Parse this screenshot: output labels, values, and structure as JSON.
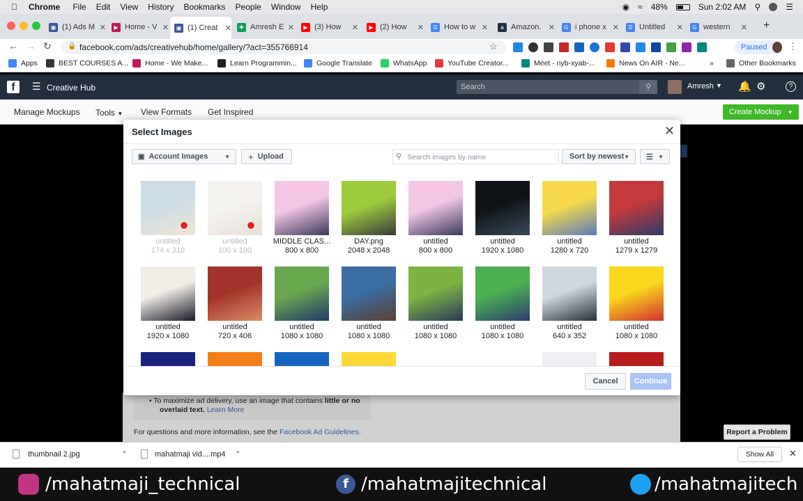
{
  "macmenu": {
    "app": "Chrome",
    "items": [
      "File",
      "Edit",
      "View",
      "History",
      "Bookmarks",
      "People",
      "Window",
      "Help"
    ],
    "battery": "48%",
    "clock": "Sun 2:02 AM"
  },
  "tabs": [
    {
      "label": "(1) Ads M",
      "icon_color": "#3b5998",
      "glyph": "▣"
    },
    {
      "label": "Home - V",
      "icon_color": "#c2185b",
      "glyph": "▶"
    },
    {
      "label": "(1) Creat",
      "icon_color": "#3b5998",
      "glyph": "▣"
    },
    {
      "label": "Amresh E",
      "icon_color": "#0f9d58",
      "glyph": "✚"
    },
    {
      "label": "(3) How",
      "icon_color": "#ff0000",
      "glyph": "▶"
    },
    {
      "label": "(2) How",
      "icon_color": "#ff0000",
      "glyph": "▶"
    },
    {
      "label": "How to w",
      "icon_color": "#4285f4",
      "glyph": "☰"
    },
    {
      "label": "Amazon.",
      "icon_color": "#232f3e",
      "glyph": "a"
    },
    {
      "label": "i phone x",
      "icon_color": "#4285f4",
      "glyph": "G"
    },
    {
      "label": "Untitled",
      "icon_color": "#4285f4",
      "glyph": "☰"
    },
    {
      "label": "western",
      "icon_color": "#4285f4",
      "glyph": "G"
    }
  ],
  "address": {
    "url": "facebook.com/ads/creativehub/home/gallery/?act=355766914",
    "paused": "Paused"
  },
  "bookmarks": [
    {
      "label": "Apps",
      "color": "#4285f4"
    },
    {
      "label": "BEST COURSES A...",
      "color": "#333"
    },
    {
      "label": "Home - We Make...",
      "color": "#c2185b"
    },
    {
      "label": "Learn Programmin...",
      "color": "#222"
    },
    {
      "label": "Google Translate",
      "color": "#4285f4"
    },
    {
      "label": "WhatsApp",
      "color": "#25d366"
    },
    {
      "label": "YouTube Creator...",
      "color": "#e53935"
    },
    {
      "label": "Meet - nyb-xyab-...",
      "color": "#00897b"
    },
    {
      "label": "News On AIR - Ne...",
      "color": "#f57c00"
    },
    {
      "label": "Other Bookmarks",
      "color": "#666"
    }
  ],
  "fbheader": {
    "title": "Creative Hub",
    "search_placeholder": "Search",
    "user": "Amresh"
  },
  "subnav": {
    "manage": "Manage Mockups",
    "tools": "Tools",
    "formats": "View Formats",
    "inspired": "Get Inspired",
    "create": "Create Mockup"
  },
  "modal": {
    "title": "Select Images",
    "source": "Account Images",
    "upload": "Upload",
    "search_placeholder": "Search images by name",
    "sort": "Sort by newest",
    "cancel": "Cancel",
    "continue": "Continue"
  },
  "images": [
    {
      "name": "untitled",
      "size": "174 x 310",
      "dim": true,
      "c1": "#8fb3c9",
      "c2": "#d8c79a"
    },
    {
      "name": "untitled",
      "size": "100 x 100",
      "dim": true,
      "c1": "#e6e2dc",
      "c2": "#c9b9a8"
    },
    {
      "name": "MIDDLE CLAS...",
      "size": "800 x 800",
      "dim": false,
      "c1": "#f3c6e6",
      "c2": "#3a3a5a"
    },
    {
      "name": "DAY.png",
      "size": "2048 x 2048",
      "dim": false,
      "c1": "#9ccc3c",
      "c2": "#3b3b3b"
    },
    {
      "name": "untitled",
      "size": "800 x 800",
      "dim": false,
      "c1": "#f3c6e6",
      "c2": "#3a3a5a"
    },
    {
      "name": "untitled",
      "size": "1920 x 1080",
      "dim": false,
      "c1": "#101418",
      "c2": "#3a4a5a"
    },
    {
      "name": "untitled",
      "size": "1280 x 720",
      "dim": false,
      "c1": "#f5d94a",
      "c2": "#5a7bbd"
    },
    {
      "name": "untitled",
      "size": "1279 x 1279",
      "dim": false,
      "c1": "#c33a3a",
      "c2": "#2b3b6a"
    },
    {
      "name": "untitled",
      "size": "1920 x 1080",
      "dim": false,
      "c1": "#f0ece6",
      "c2": "#1a1a2a"
    },
    {
      "name": "untitled",
      "size": "720 x 406",
      "dim": false,
      "c1": "#a3332a",
      "c2": "#d98b66"
    },
    {
      "name": "untitled",
      "size": "1080 x 1080",
      "dim": false,
      "c1": "#6aa84f",
      "c2": "#1f3a6a"
    },
    {
      "name": "untitled",
      "size": "1080 x 1080",
      "dim": false,
      "c1": "#3a6ea5",
      "c2": "#5a4032"
    },
    {
      "name": "untitled",
      "size": "1080 x 1080",
      "dim": false,
      "c1": "#7cb342",
      "c2": "#2a3a5a"
    },
    {
      "name": "untitled",
      "size": "1080 x 1080",
      "dim": false,
      "c1": "#4caf50",
      "c2": "#2c3e70"
    },
    {
      "name": "untitled",
      "size": "640 x 352",
      "dim": false,
      "c1": "#cfd8dc",
      "c2": "#263238"
    },
    {
      "name": "untitled",
      "size": "1080 x 1080",
      "dim": false,
      "c1": "#f9d71c",
      "c2": "#d32f2f"
    },
    {
      "name": "",
      "size": "",
      "dim": false,
      "c1": "#1a237e",
      "c2": "#5c6bc0"
    },
    {
      "name": "",
      "size": "",
      "dim": false,
      "c1": "#f57f17",
      "c2": "#4e342e"
    },
    {
      "name": "",
      "size": "",
      "dim": false,
      "c1": "#1565c0",
      "c2": "#ec407a"
    },
    {
      "name": "",
      "size": "",
      "dim": false,
      "c1": "#fdd835",
      "c2": "#7e57c2"
    },
    {
      "name": "",
      "size": "",
      "dim": false,
      "c1": "#ffffff",
      "c2": "#9e9e9e"
    },
    {
      "name": "",
      "size": "",
      "dim": false,
      "c1": "#ffffff",
      "c2": "#3949ab"
    },
    {
      "name": "",
      "size": "",
      "dim": false,
      "c1": "#eceff1",
      "c2": "#42a5f5"
    },
    {
      "name": "",
      "size": "",
      "dim": false,
      "c1": "#b71c1c",
      "c2": "#212121"
    }
  ],
  "behind": {
    "line1a": "To maximize ad delivery, use an image that contains ",
    "line1b": "little or no",
    "line2a": "overlaid text.",
    "line2b": "Learn More",
    "guide_a": "For questions and more information, see the ",
    "guide_b": "Facebook Ad Guidelines",
    "guide_c": ".",
    "report": "Report a Problem"
  },
  "downloads": {
    "file1": "thumbnail 2.jpg",
    "file2": "mahatmaji vid....mp4",
    "show_all": "Show All"
  },
  "social": {
    "instagram": "/mahatmaji_technical",
    "facebook": "/mahatmajitechnical",
    "twitter": "/mahatmajitech"
  }
}
